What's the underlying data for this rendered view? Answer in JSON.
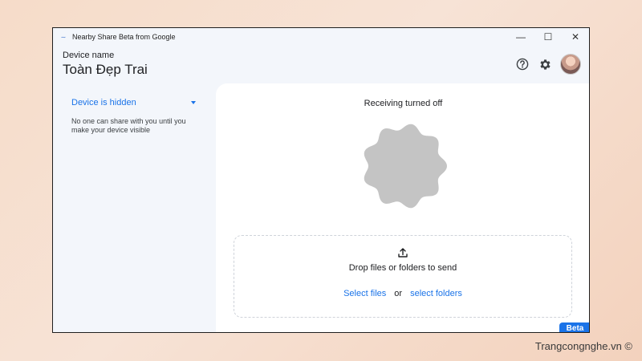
{
  "window": {
    "title": "Nearby Share Beta from Google",
    "controls": {
      "minimize": "—",
      "maximize": "☐",
      "close": "✕"
    }
  },
  "header": {
    "device_name_label": "Device name",
    "device_name": "Toàn Đẹp Trai",
    "icons": [
      "help-icon",
      "gear-icon",
      "avatar"
    ]
  },
  "sidebar": {
    "visibility": "Device is hidden",
    "description": "No one can share with you until you make your device visible"
  },
  "main": {
    "status": "Receiving turned off",
    "dropzone": {
      "text": "Drop files or folders to send",
      "select_files": "Select files",
      "or": "or",
      "select_folders": "select folders"
    },
    "badge": "Beta"
  },
  "colors": {
    "accent": "#1a73e8",
    "badge_shape": "#c4c4c4",
    "window_bg": "#f3f6fb"
  },
  "watermark": "Trangcongnghe.vn ©"
}
